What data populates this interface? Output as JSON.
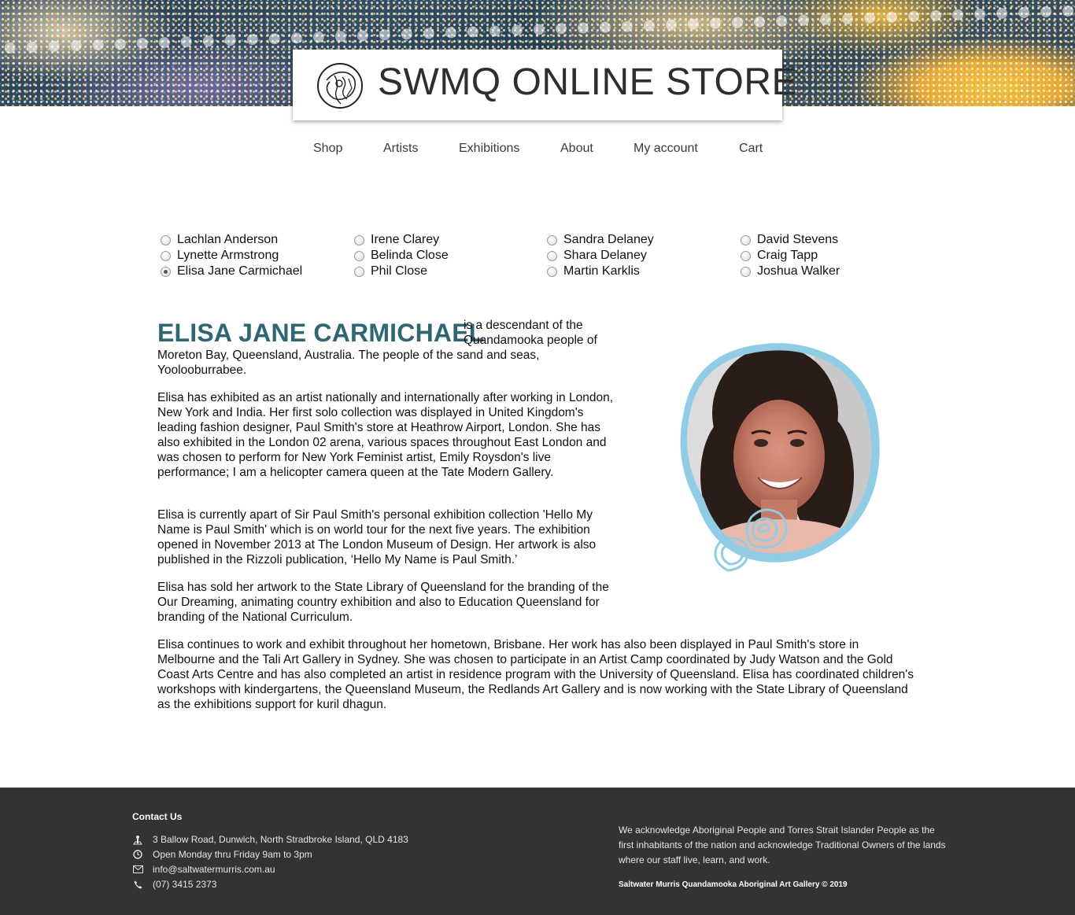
{
  "header": {
    "title": "SWMQ ONLINE STORE",
    "logo_icon": "circular-artwork-logo"
  },
  "nav": {
    "items": [
      {
        "label": "Shop"
      },
      {
        "label": "Artists"
      },
      {
        "label": "Exhibitions"
      },
      {
        "label": "About"
      },
      {
        "label": "My account"
      },
      {
        "label": "Cart"
      }
    ]
  },
  "artists": {
    "selected": "Elisa Jane Carmichael",
    "columns": [
      [
        "Lachlan Anderson",
        "Lynette Armstrong",
        "Elisa Jane Carmichael"
      ],
      [
        "Irene Clarey",
        "Belinda Close",
        "Phil Close"
      ],
      [
        "Sandra Delaney",
        "Shara Delaney",
        "Martin Karklis"
      ],
      [
        "David Stevens",
        "Craig Tapp",
        "Joshua Walker"
      ]
    ]
  },
  "bio": {
    "name": "ELISA JANE CARMICHAEL",
    "intro_inline": "is a descendant of the Quandamooka people of",
    "intro_rest": "Moreton Bay, Queensland, Australia. The people of the sand and seas, Yoolooburrabee.",
    "p2": "Elisa has exhibited as an artist nationally and internationally after working in London, New York and India. Her first solo collection was displayed in United Kingdom's leading fashion designer, Paul Smith's store at Heathrow Airport, London. She has also exhibited in the London 02 arena, various spaces throughout East London and was chosen to perform for New York Feminist artist, Emily Roysdon's live performance; I am a helicopter camera queen at the Tate Modern Gallery.",
    "p3": "Elisa is currently apart of Sir Paul Smith's personal exhibition collection 'Hello My Name is Paul Smith' which is on world tour for the next five years. The exhibition opened in November 2013 at The London Museum of Design. Her artwork is also published in the Rizzoli publication, ‘Hello My Name is Paul Smith.’",
    "p4": "Elisa has sold her artwork to the State Library of Queensland for the branding of the Our Dreaming, animating country exhibition and also to Education Queensland for branding of the National Curriculum.",
    "p5": "Elisa continues to work and exhibit throughout her hometown, Brisbane. Her work has also been displayed in Paul Smith's store in Melbourne and the Tali Art Gallery in Sydney. She was chosen to participate in an Artist Camp coordinated by Judy Watson and the Gold Coast Arts Centre and has also completed an artist in residence program with the University of Queensland. Elisa has coordinated children's workshops with kindergartens, the Queensland Museum, the Redlands Art Gallery and is now working with the State Library of Queensland as the exhibitions support for kuril dhagun."
  },
  "footer": {
    "contact_heading": "Contact Us",
    "address": "3 Ballow Road, Dunwich, North Stradbroke Island, QLD 4183",
    "hours": "Open Monday thru Friday 9am to 3pm",
    "email": "info@saltwatermurris.com.au",
    "phone": "(07) 3415 2373",
    "acknowledgement": "We acknowledge Aboriginal People and Torres Strait Islander People as the first inhabitants of the nation and acknowledge Traditional Owners of the lands where our staff live, learn, and work.",
    "copyright": "Saltwater Murris Quandamooka Aboriginal Art Gallery © 2019"
  },
  "colors": {
    "name_accent": "#2d6774",
    "photo_frame": "#8fcde6",
    "footer_bg": "#333333"
  }
}
